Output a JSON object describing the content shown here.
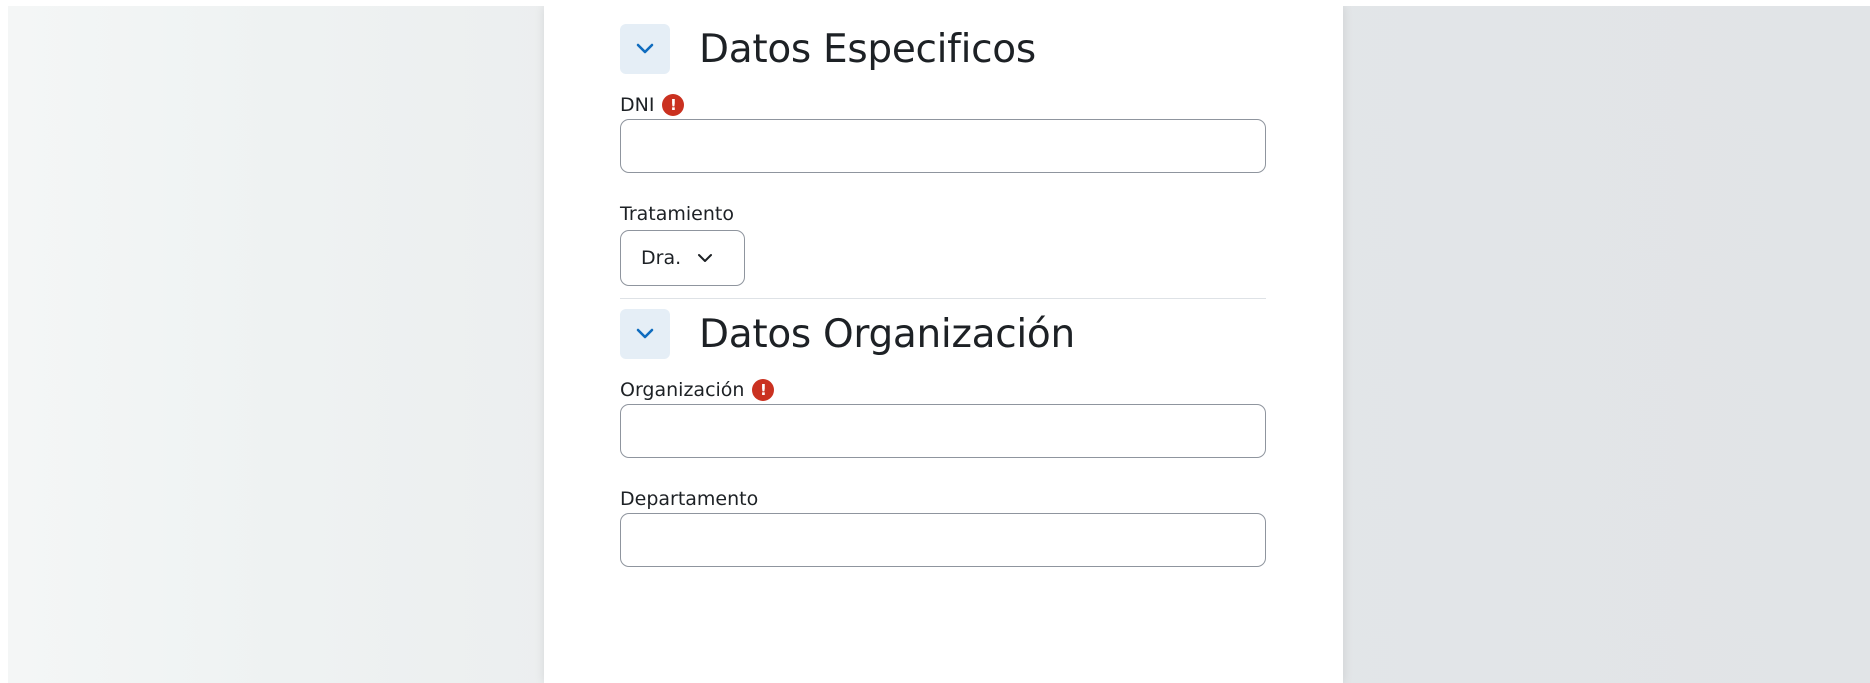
{
  "sections": {
    "specific": {
      "title": "Datos Especificos",
      "toggle_icon": "chevron-down-icon",
      "fields": {
        "dni": {
          "label": "DNI",
          "required": true,
          "value": ""
        },
        "tratamiento": {
          "label": "Tratamiento",
          "selected": "Dra."
        }
      }
    },
    "organization": {
      "title": "Datos Organización",
      "toggle_icon": "chevron-down-icon",
      "fields": {
        "organizacion": {
          "label": "Organización",
          "required": true,
          "value": ""
        },
        "departamento": {
          "label": "Departamento",
          "value": ""
        }
      }
    }
  },
  "icons": {
    "required": "!"
  },
  "colors": {
    "accent": "#0f6cbf",
    "required": "#ca3120",
    "toggle_bg": "#e5eef6",
    "text": "#1d2125",
    "input_border": "#8f959e"
  }
}
